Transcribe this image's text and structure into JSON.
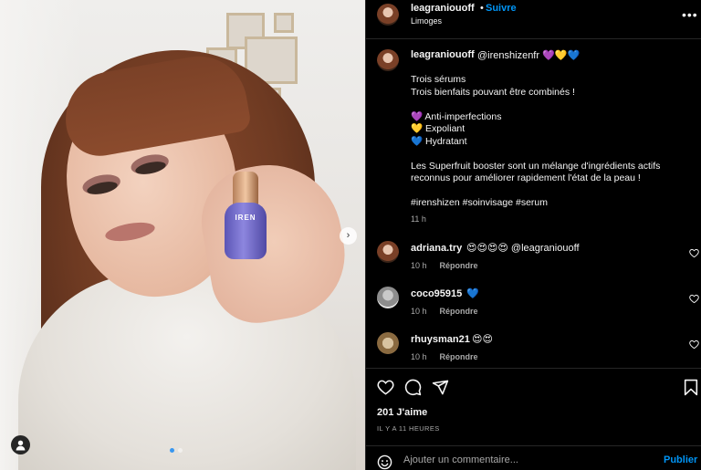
{
  "post": {
    "username": "leagraniouoff",
    "separator": "•",
    "follow_label": "Suivre",
    "location": "Limoges",
    "more_icon": "more-horizontal-icon",
    "product_brand": "IREN"
  },
  "caption": {
    "username": "leagraniouoff",
    "mention": "@irenshizenfr 💜💛💙",
    "lines": [
      "Trois sérums",
      "Trois bienfaits pouvant être combinés !",
      "",
      "💜 Anti-imperfections",
      "💛 Expoliant",
      "💙 Hydratant",
      "",
      "Les Superfruit booster sont un mélange d'ingrédients actifs",
      "reconnus pour améliorer rapidement l'état de la peau !",
      "",
      "#irenshizen #soinvisage #serum"
    ],
    "time": "11 h"
  },
  "comments": [
    {
      "username": "adriana.try",
      "text": "😍😍😍😍 @leagraniouoff",
      "time": "10 h",
      "reply_label": "Répondre"
    },
    {
      "username": "coco95915",
      "text": "💙",
      "time": "10 h",
      "reply_label": "Répondre"
    },
    {
      "username": "rhuysman21",
      "text": "😍😍",
      "time": "10 h",
      "reply_label": "Répondre"
    }
  ],
  "engagement": {
    "likes": "201 J'aime",
    "posted": "IL Y A 11 HEURES"
  },
  "comment_box": {
    "placeholder": "Ajouter un commentaire...",
    "publish_label": "Publier"
  },
  "colors": {
    "background": "#000000",
    "accent_blue": "#0095f6",
    "muted_text": "#a8a8a8",
    "divider": "#262626"
  }
}
